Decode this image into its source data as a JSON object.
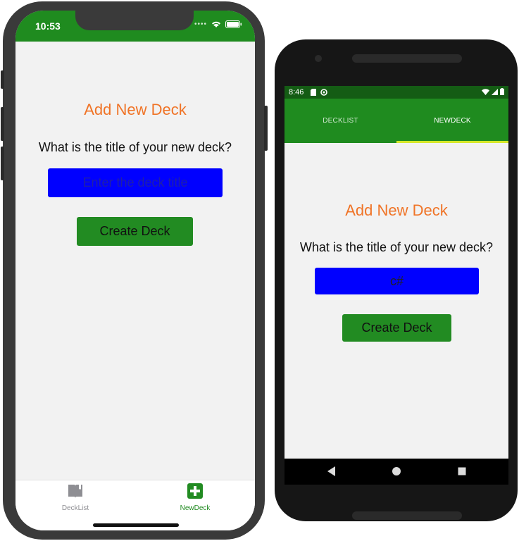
{
  "colors": {
    "header_green": "#1f8b1f",
    "android_status_green": "#145c14",
    "button_green": "#228b22",
    "title_orange": "#f07427",
    "input_blue": "#0000ff",
    "tab_indicator": "#d6e82a",
    "ios_active_tab": "#228b22",
    "ios_inactive_tab": "#8e8e93"
  },
  "iphone": {
    "status": {
      "time": "10:53",
      "icons": [
        "signal-dots-icon",
        "wifi-icon",
        "battery-icon"
      ]
    },
    "screen": {
      "title": "Add New Deck",
      "question": "What is the title of your new deck?",
      "input": {
        "value": "",
        "placeholder": "Enter the deck title"
      },
      "create_button": "Create Deck"
    },
    "tabbar": {
      "tabs": [
        {
          "label": "DeckList",
          "icon": "book-icon",
          "active": false
        },
        {
          "label": "NewDeck",
          "icon": "plus-square-icon",
          "active": true
        }
      ]
    }
  },
  "android": {
    "status": {
      "time": "8:46",
      "left_icons": [
        "sd-card-icon",
        "sync-icon"
      ],
      "right_icons": [
        "wifi-icon",
        "signal-icon",
        "battery-icon"
      ]
    },
    "tabs": [
      {
        "label": "DECKLIST",
        "active": false
      },
      {
        "label": "NEWDECK",
        "active": true
      }
    ],
    "screen": {
      "title": "Add New Deck",
      "question": "What is the title of your new deck?",
      "input": {
        "value": "c#",
        "placeholder": ""
      },
      "create_button": "Create Deck"
    },
    "navbar": [
      "back-icon",
      "home-icon",
      "recents-icon"
    ]
  }
}
